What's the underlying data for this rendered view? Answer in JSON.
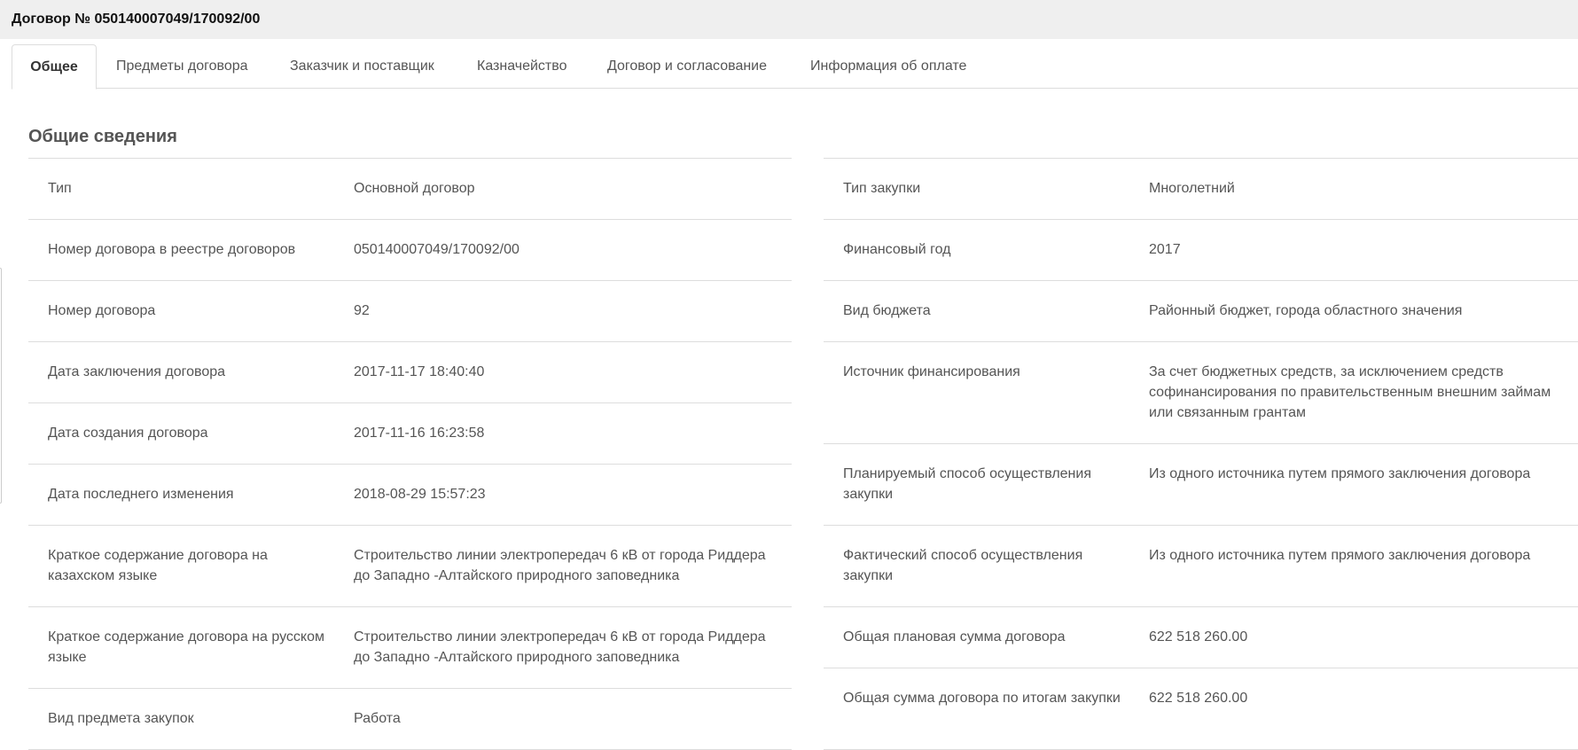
{
  "page": {
    "title": "Договор № 050140007049/170092/00"
  },
  "tabs": [
    {
      "label": "Общее"
    },
    {
      "label": "Предметы договора"
    },
    {
      "label": "Заказчик и поставщик"
    },
    {
      "label": "Казначейство"
    },
    {
      "label": "Договор и согласование"
    },
    {
      "label": "Информация об оплате"
    }
  ],
  "section": {
    "title": "Общие сведения"
  },
  "left_rows": [
    {
      "label": "Тип",
      "value": "Основной договор"
    },
    {
      "label": "Номер договора в реестре договоров",
      "value": "050140007049/170092/00"
    },
    {
      "label": "Номер договора",
      "value": "92"
    },
    {
      "label": "Дата заключения договора",
      "value": "2017-11-17 18:40:40"
    },
    {
      "label": "Дата создания договора",
      "value": "2017-11-16 16:23:58"
    },
    {
      "label": "Дата последнего изменения",
      "value": "2018-08-29 15:57:23"
    },
    {
      "label": "Краткое содержание договора на казахском языке",
      "value": "Строительство линии электропередач 6 кВ от города Риддера до Западно -Алтайского природного заповедника"
    },
    {
      "label": "Краткое содержание договора на русском языке",
      "value": "Строительство линии электропередач 6 кВ от города Риддера до Западно -Алтайского природного заповедника"
    },
    {
      "label": "Вид предмета закупок",
      "value": "Работа"
    }
  ],
  "right_rows": [
    {
      "label": "Тип закупки",
      "value": "Многолетний"
    },
    {
      "label": "Финансовый год",
      "value": "2017"
    },
    {
      "label": "Вид бюджета",
      "value": "Районный бюджет, города областного значения"
    },
    {
      "label": "Источник финансирования",
      "value": "За счет бюджетных средств, за исключением средств софинансирования по правительственным внешним займам или связанным грантам"
    },
    {
      "label": "Планируемый способ осуществления закупки",
      "value": "Из одного источника путем прямого заключения договора"
    },
    {
      "label": "Фактический способ осуществления закупки",
      "value": "Из одного источника путем прямого заключения договора"
    },
    {
      "label": "Общая плановая сумма договора",
      "value": "622 518 260.00"
    },
    {
      "label": "Общая сумма договора по итогам закупки",
      "value": "622 518 260.00"
    }
  ]
}
